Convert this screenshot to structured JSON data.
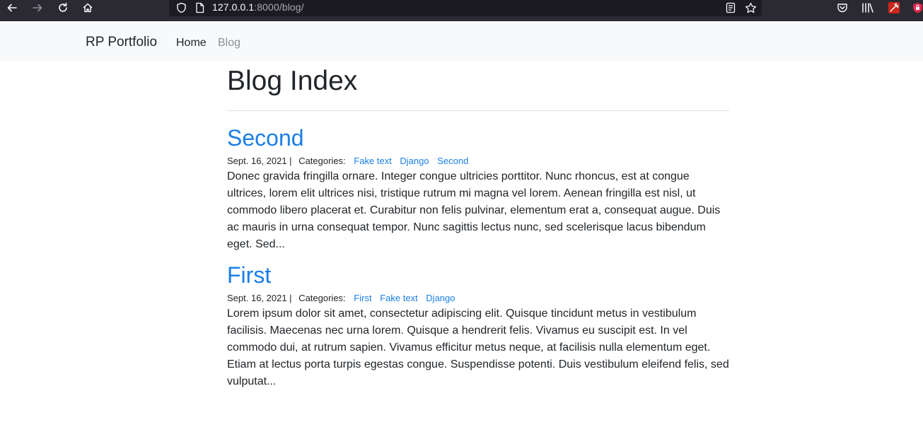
{
  "browser": {
    "url_host": "127.0.0.1",
    "url_rest": ":8000/blog/"
  },
  "navbar": {
    "brand": "RP Portfolio",
    "links": [
      "Home",
      "Blog"
    ]
  },
  "page": {
    "title": "Blog Index"
  },
  "posts": [
    {
      "title": "Second",
      "date": "Sept. 16, 2021 |",
      "categories_label": "Categories:",
      "categories": [
        "Fake text",
        "Django",
        "Second"
      ],
      "excerpt": "Donec gravida fringilla ornare. Integer congue ultricies porttitor. Nunc rhoncus, est at congue ultrices, lorem elit ultrices nisi, tristique rutrum mi magna vel lorem. Aenean fringilla est nisl, ut commodo libero placerat et. Curabitur non felis pulvinar, elementum erat a, consequat augue. Duis ac mauris in urna consequat tempor. Nunc sagittis lectus nunc, sed scelerisque lacus bibendum eget. Sed..."
    },
    {
      "title": "First",
      "date": "Sept. 16, 2021 |",
      "categories_label": "Categories:",
      "categories": [
        "First",
        "Fake text",
        "Django"
      ],
      "excerpt": "Lorem ipsum dolor sit amet, consectetur adipiscing elit. Quisque tincidunt metus in vestibulum facilisis. Maecenas nec urna lorem. Quisque a hendrerit felis. Vivamus eu suscipit est. In vel commodo dui, at rutrum sapien. Vivamus efficitur metus neque, at facilisis nulla elementum eget. Etiam at lectus porta turpis egestas congue. Suspendisse potenti. Duis vestibulum eleifend felis, sed vulputat..."
    }
  ],
  "colors": {
    "link": "#1a7fe6",
    "navbar_bg": "#f8f9fa",
    "chrome_bg": "#2b2a33"
  },
  "icons": [
    "back-arrow-icon",
    "forward-arrow-icon",
    "reload-icon",
    "home-icon",
    "shield-icon",
    "page-icon",
    "reader-view-icon",
    "bookmark-star-icon",
    "pocket-icon",
    "library-icon",
    "extension-icon",
    "lock-extension-icon"
  ]
}
